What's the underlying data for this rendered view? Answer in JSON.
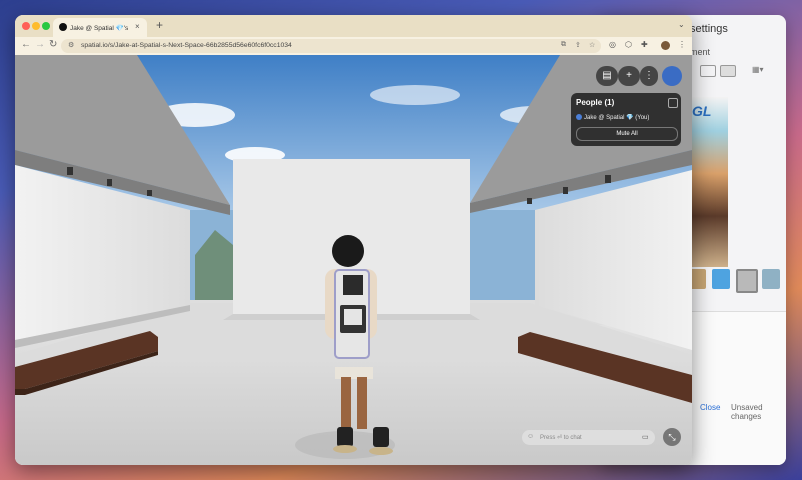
{
  "settings_window": {
    "title": "settings",
    "subtitle": "ment",
    "close_label": "Close",
    "unsaved_label": "Unsaved changes",
    "preview_text": "GL"
  },
  "browser": {
    "tab_title": "Jake @ Spatial 💎's Next",
    "url": "spatial.io/s/Jake-at-Spatial-s-Next-Space-66b2855d56e60fc6f0cc1034",
    "new_tab_glyph": "+",
    "close_tab_glyph": "×"
  },
  "space": {
    "people_title": "People (1)",
    "person_entry": "Jake @ Spatial 💎 (You)",
    "mute_all_label": "Mute All",
    "chat_placeholder": "Press ⏎ to chat",
    "add_glyph": "+",
    "more_glyph": "⋮",
    "fullscreen_glyph": "⤡"
  },
  "colors": {
    "ceiling": "#9e9e9e",
    "floor": "#d9d9d9",
    "walls": "#ededed",
    "bench": "#5a3424",
    "sky": "#6aa0d8"
  }
}
